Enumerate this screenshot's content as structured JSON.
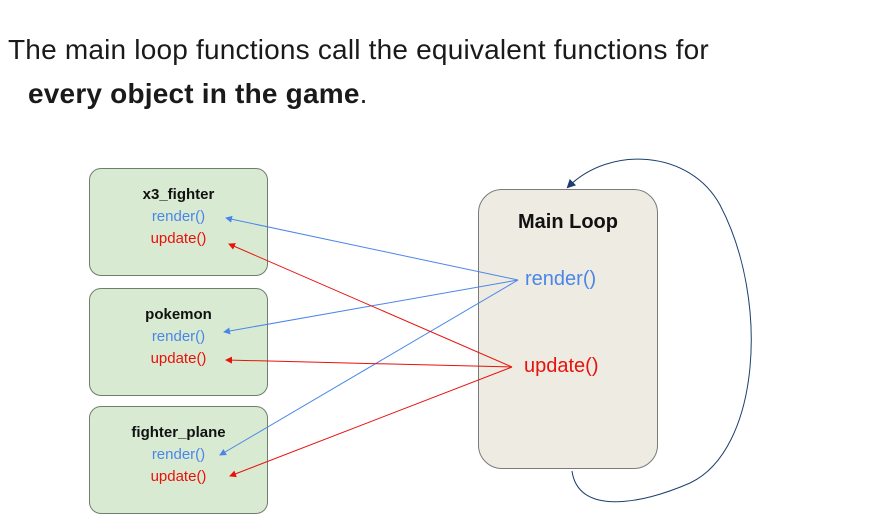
{
  "caption": {
    "line1": "The main loop functions call the equivalent functions for",
    "line2_bold": "every object in the game",
    "line2_end": "."
  },
  "objects": [
    {
      "name": "x3_fighter",
      "render": "render()",
      "update": "update()"
    },
    {
      "name": "pokemon",
      "render": "render()",
      "update": "update()"
    },
    {
      "name": "fighter_plane",
      "render": "render()",
      "update": "update()"
    }
  ],
  "main_loop": {
    "title": "Main Loop",
    "render": "render()",
    "update": "update()"
  },
  "colors": {
    "render": "#4a86e8",
    "update": "#e8120c",
    "object_fill": "#d9ead3",
    "loop_fill": "#eeebe2",
    "cycle_arrow": "#1c3f6e"
  }
}
